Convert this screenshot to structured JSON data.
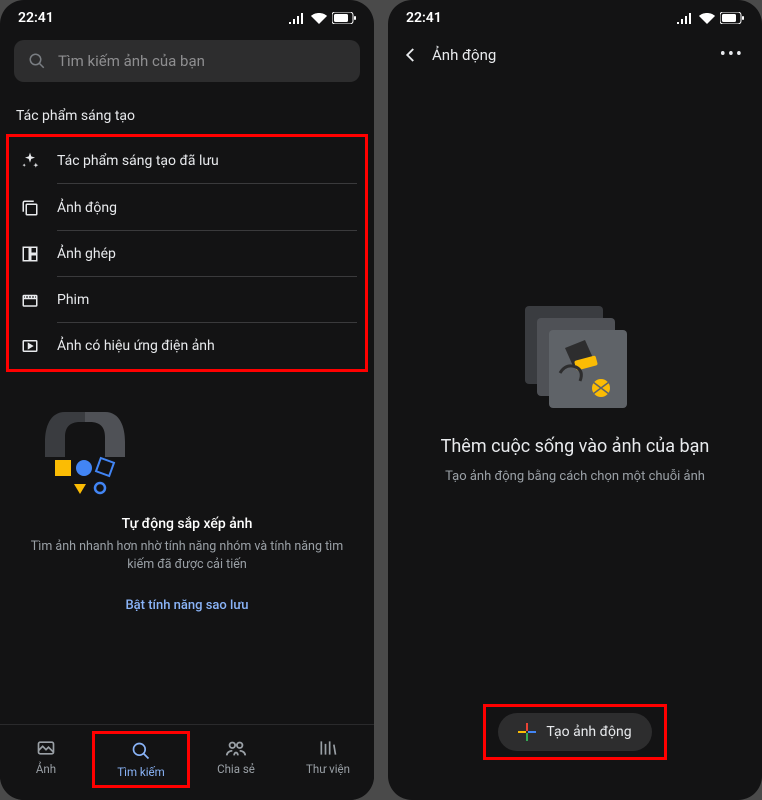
{
  "status": {
    "time": "22:41"
  },
  "left": {
    "search": {
      "placeholder": "Tìm kiếm ảnh của bạn"
    },
    "section_title": "Tác phẩm sáng tạo",
    "items": [
      {
        "label": "Tác phẩm sáng tạo đã lưu"
      },
      {
        "label": "Ảnh động"
      },
      {
        "label": "Ảnh ghép"
      },
      {
        "label": "Phim"
      },
      {
        "label": "Ảnh có hiệu ứng điện ảnh"
      }
    ],
    "promo": {
      "title": "Tự động sắp xếp ảnh",
      "sub": "Tìm ảnh nhanh hơn nhờ tính năng nhóm và tính năng tìm kiếm đã được cải tiến"
    },
    "backup_link": "Bật tính năng sao lưu",
    "nav": [
      {
        "label": "Ảnh"
      },
      {
        "label": "Tìm kiếm"
      },
      {
        "label": "Chia sẻ"
      },
      {
        "label": "Thư viện"
      }
    ]
  },
  "right": {
    "header": {
      "title": "Ảnh động"
    },
    "empty": {
      "title": "Thêm cuộc sống vào ảnh của bạn",
      "sub": "Tạo ảnh động bằng cách chọn một chuỗi ảnh"
    },
    "cta": {
      "label": "Tạo ảnh động"
    }
  }
}
